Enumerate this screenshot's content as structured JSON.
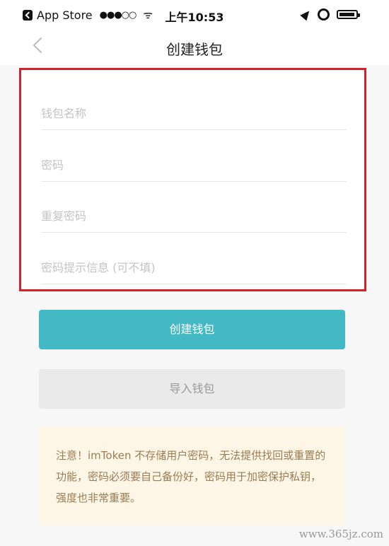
{
  "status_bar": {
    "back_app": "App Store",
    "signal": "●●●○○",
    "wifi": "ᯤ",
    "time": "上午10:53"
  },
  "nav": {
    "title": "创建钱包"
  },
  "form": {
    "wallet_name_placeholder": "钱包名称",
    "password_placeholder": "密码",
    "repeat_password_placeholder": "重复密码",
    "password_hint_placeholder": "密码提示信息 (可不填)"
  },
  "buttons": {
    "create_label": "创建钱包",
    "import_label": "导入钱包"
  },
  "notice": {
    "text": "注意！imToken 不存储用户密码，无法提供找回或重置的功能，密码必须要自己备份好，密码用于加密保护私钥，强度也非常重要。"
  },
  "watermark": "www.365jz.com",
  "colors": {
    "highlight_border": "#d81f2a",
    "primary_button": "#43b9c5",
    "secondary_button": "#eaeaea",
    "notice_bg": "#fdf6e6",
    "notice_text": "#9c7b53"
  },
  "icons": {
    "back": "chevron-left-icon",
    "location": "location-arrow-icon",
    "alarm": "alarm-icon",
    "battery": "battery-icon"
  }
}
